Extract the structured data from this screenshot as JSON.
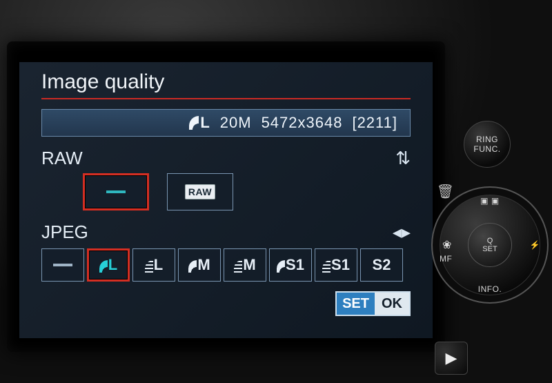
{
  "screen": {
    "title": "Image quality",
    "status": {
      "quality_icon": "fine-L",
      "megapixels": "20M",
      "resolution": "5472x3648",
      "shots_remaining": "[2211]"
    },
    "raw": {
      "label": "RAW",
      "options": [
        {
          "id": "raw-off",
          "kind": "dash",
          "selected": true
        },
        {
          "id": "raw-on",
          "kind": "raw-chip",
          "label": "RAW",
          "selected": false
        }
      ],
      "nav_icon": "updown"
    },
    "jpeg": {
      "label": "JPEG",
      "options": [
        {
          "id": "jpeg-off",
          "kind": "dash",
          "selected": false
        },
        {
          "id": "jpeg-fine-L",
          "kind": "fine",
          "letter": "L",
          "selected": true,
          "color": "cyan"
        },
        {
          "id": "jpeg-normal-L",
          "kind": "normal",
          "letter": "L",
          "selected": false
        },
        {
          "id": "jpeg-fine-M",
          "kind": "fine",
          "letter": "M",
          "selected": false
        },
        {
          "id": "jpeg-normal-M",
          "kind": "normal",
          "letter": "M",
          "selected": false
        },
        {
          "id": "jpeg-fine-S1",
          "kind": "fine",
          "letter": "S1",
          "selected": false
        },
        {
          "id": "jpeg-normal-S1",
          "kind": "normal",
          "letter": "S1",
          "selected": false
        },
        {
          "id": "jpeg-S2",
          "kind": "plain",
          "letter": "S2",
          "selected": false
        }
      ],
      "nav_icon": "leftright"
    },
    "footer": {
      "set": "SET",
      "ok": "OK"
    }
  },
  "hardware": {
    "ring_func": {
      "line1": "RING",
      "line2": "FUNC."
    },
    "trash_icon": "trash-icon",
    "play_icon": "play-icon",
    "dial": {
      "top": "",
      "bottom": "INFO.",
      "left_label": "MF",
      "center_line1": "Q",
      "center_line2": "SET"
    }
  }
}
